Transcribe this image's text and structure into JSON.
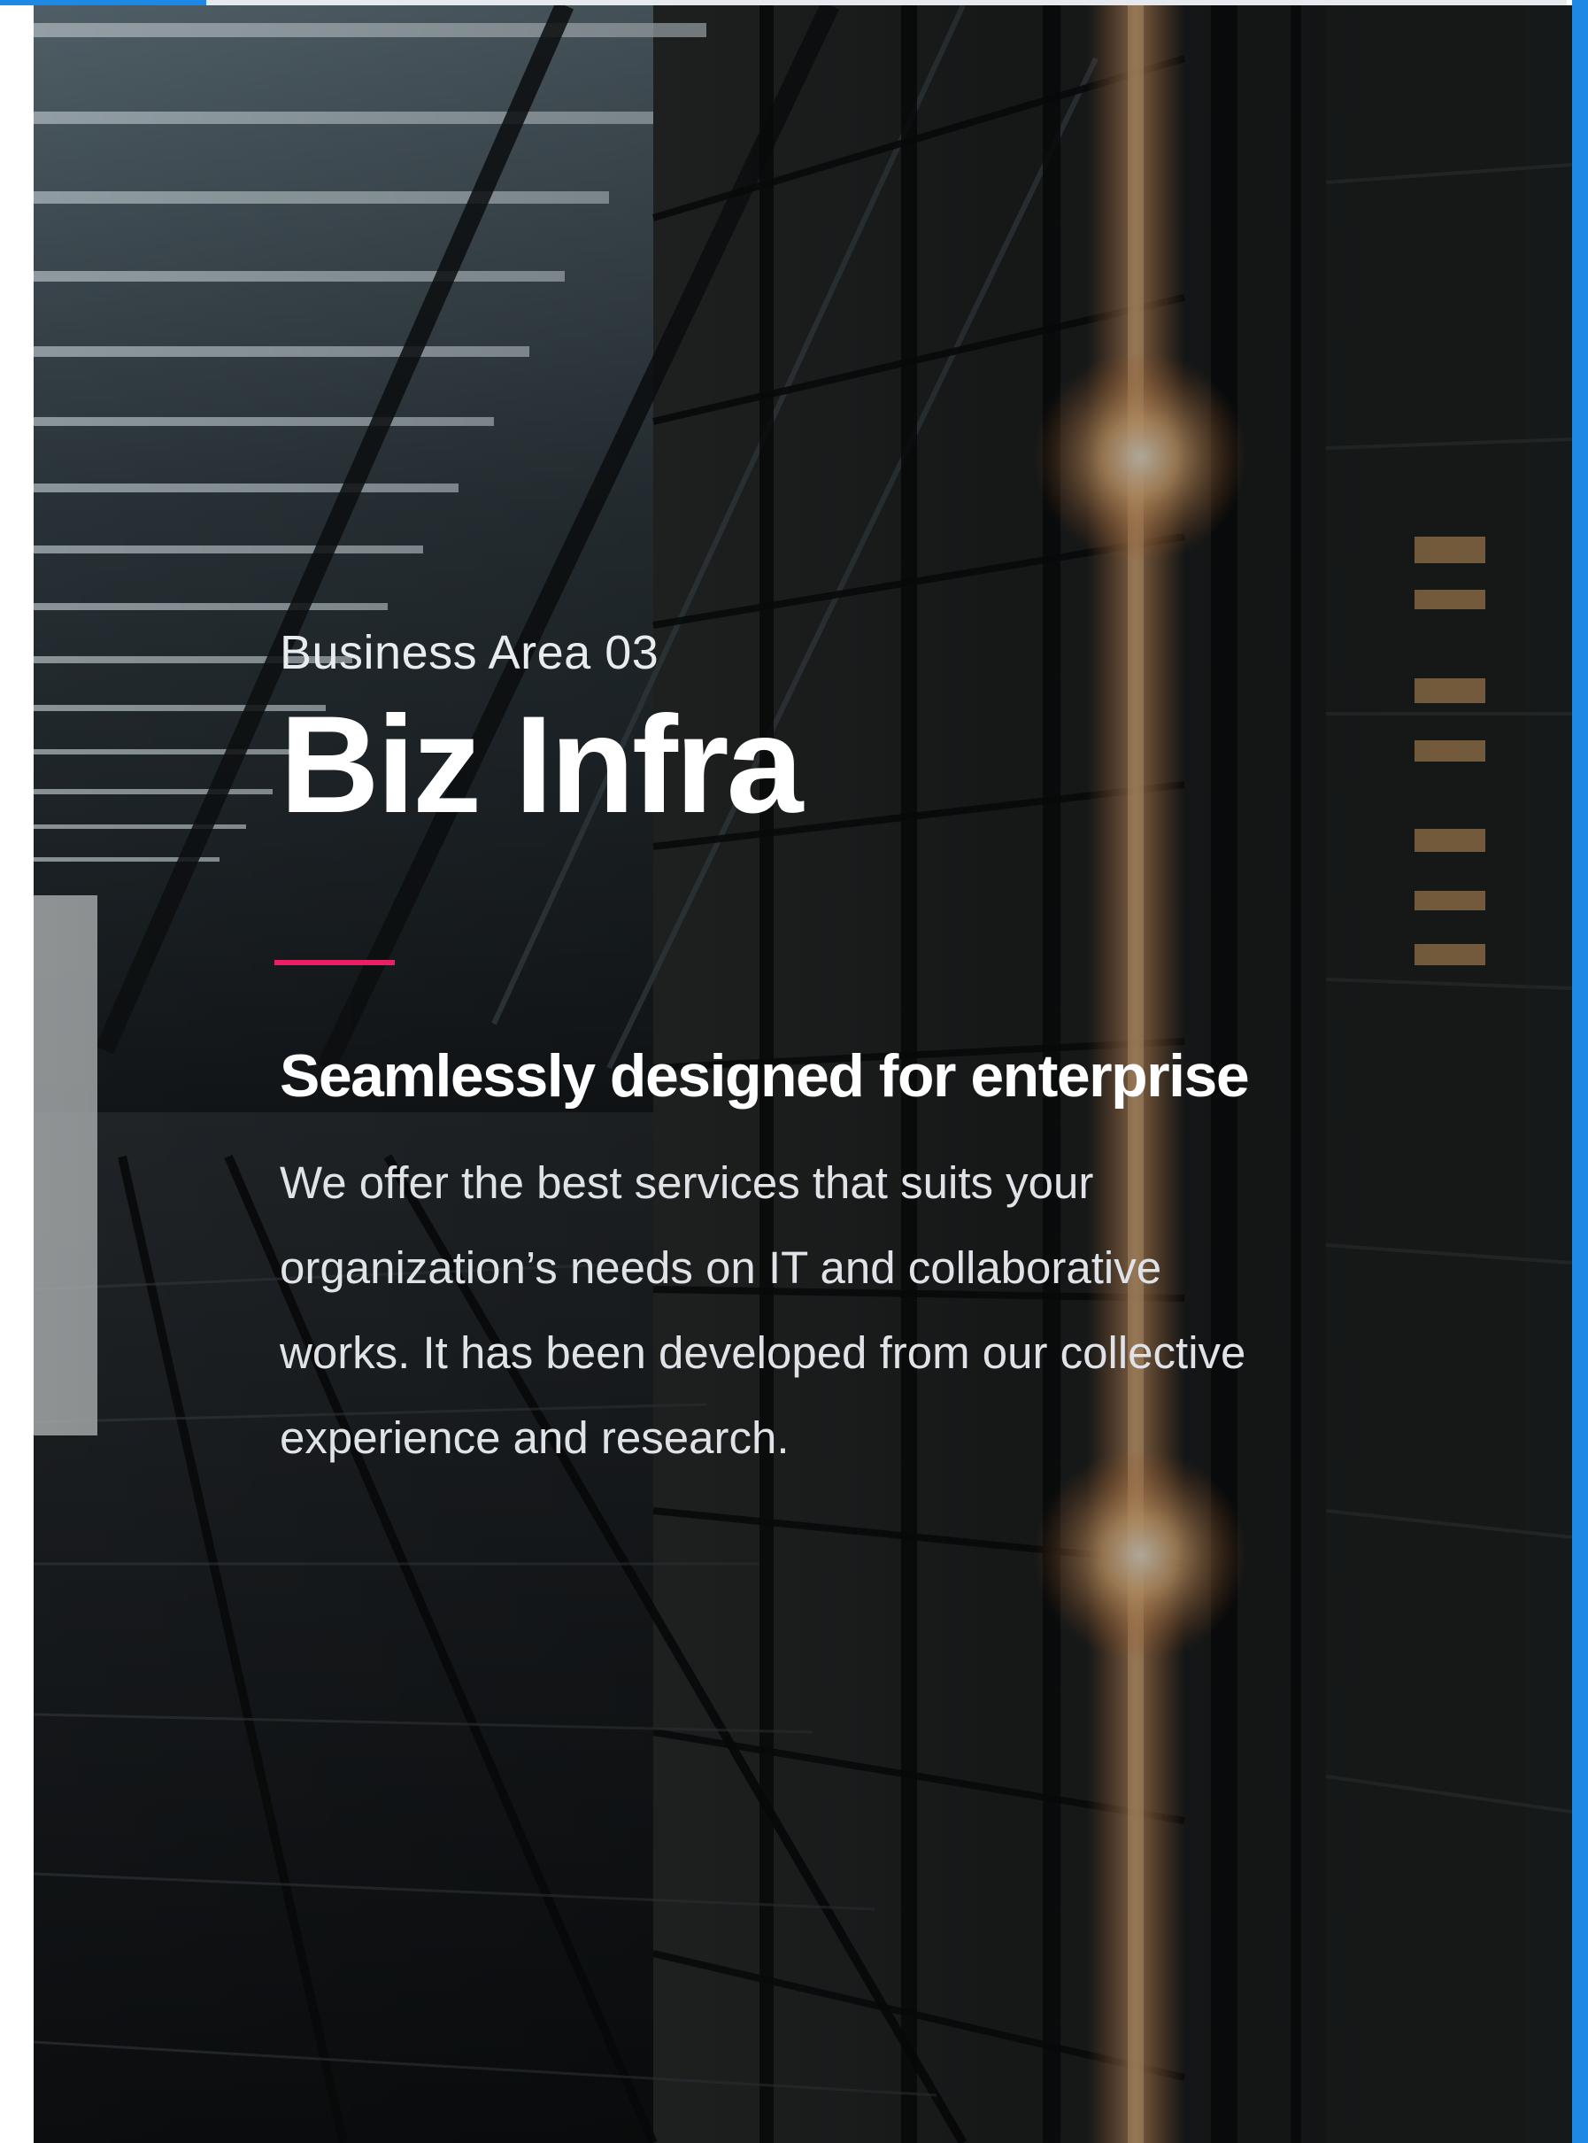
{
  "colors": {
    "progress_track": "#e6e9ee",
    "progress_fill": "#1e88e5",
    "accent_line": "#e91e63",
    "edge_accent": "#1e88e5"
  },
  "hero": {
    "image_icon": "data-center-corridor-image",
    "eyebrow": "Business Area 03",
    "title": "Biz Infra",
    "subtitle": "Seamlessly designed for enterprise",
    "body": "We offer the best services that suits your organization’s needs on IT and collaborative works. It has been developed from our collective experience and research."
  },
  "progress": {
    "fraction": 0.13
  }
}
